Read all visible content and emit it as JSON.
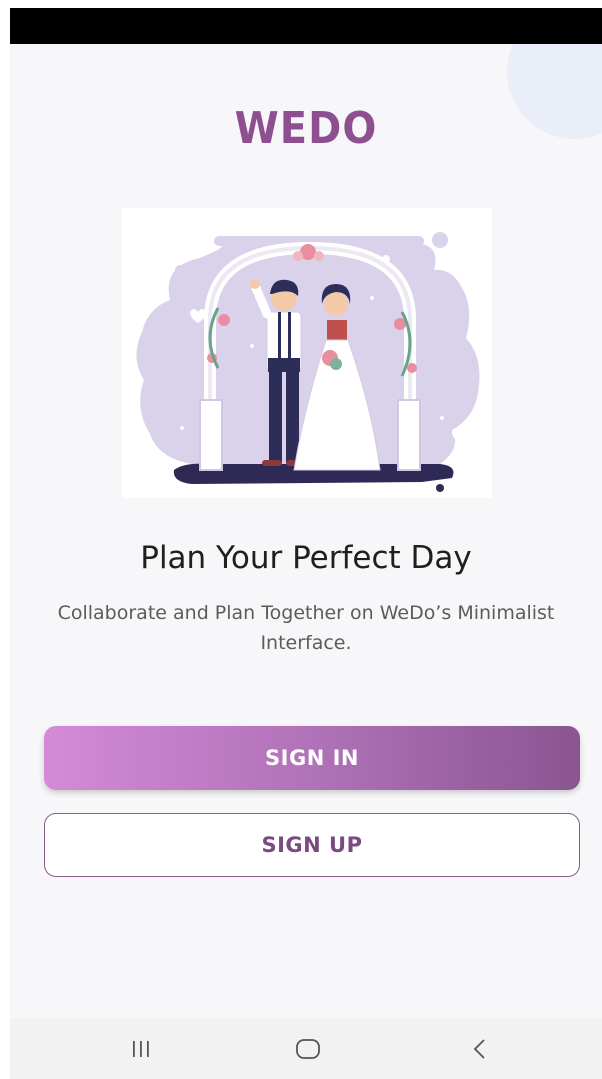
{
  "app": {
    "logo_text": "WEDO",
    "headline": "Plan Your Perfect Day",
    "subtitle": "Collaborate and Plan Together on WeDo’s Minimalist Interface."
  },
  "buttons": {
    "sign_in": "SIGN IN",
    "sign_up": "SIGN UP"
  },
  "navigation": {
    "items": [
      "recent-apps-icon",
      "home-icon",
      "back-icon"
    ]
  },
  "colors": {
    "brand": "#8e4f91",
    "sign_in_gradient": [
      "#d48ad8",
      "#8a5591"
    ],
    "sign_up_border": "#8e5b8f",
    "illustration_lavender": "#d9d2ea"
  }
}
